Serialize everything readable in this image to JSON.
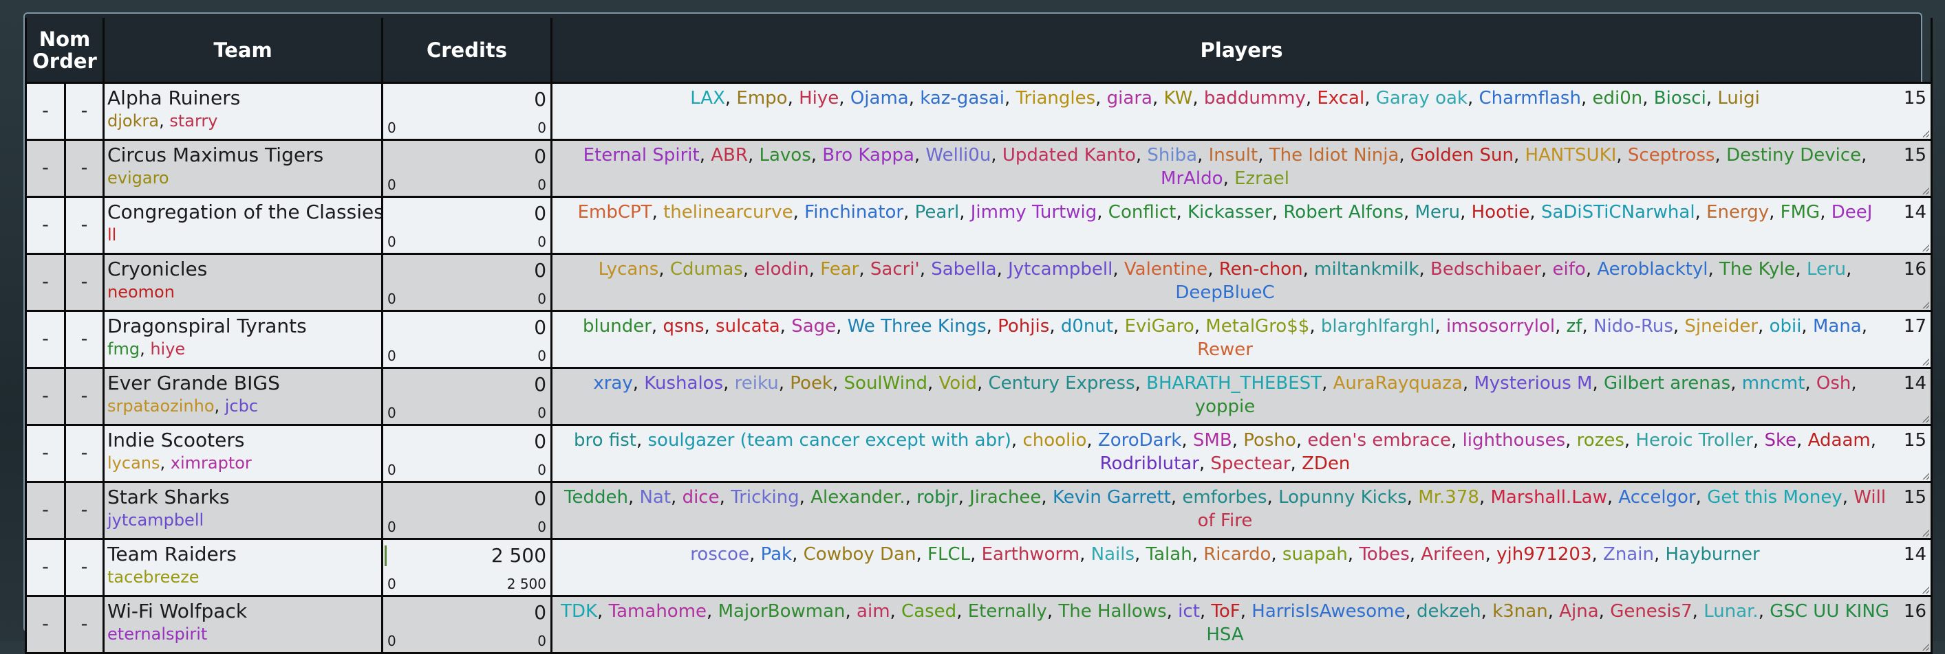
{
  "headers": {
    "order": "Nom Order",
    "team": "Team",
    "credits": "Credits",
    "players": "Players"
  },
  "rows": [
    {
      "order": "-",
      "nom": "-",
      "team": "Alpha Ruiners",
      "coaches": [
        {
          "name": "djokra",
          "color": "#9a7a16"
        },
        {
          "name": "starry",
          "color": "#c0304a"
        }
      ],
      "credits": "0",
      "credits_a": "0",
      "credits_b": "0",
      "count": "15",
      "players": [
        {
          "n": "LAX",
          "c": "#1aa6b0"
        },
        {
          "n": "Empo",
          "c": "#9a7a16"
        },
        {
          "n": "Hiye",
          "c": "#c0304a"
        },
        {
          "n": "Ojama",
          "c": "#2f6fd0"
        },
        {
          "n": "kaz-gasai",
          "c": "#2f6fd0"
        },
        {
          "n": "Triangles",
          "c": "#b8900e"
        },
        {
          "n": "giara",
          "c": "#b030a0"
        },
        {
          "n": "KW",
          "c": "#9a8a10"
        },
        {
          "n": "baddummy",
          "c": "#c0305a"
        },
        {
          "n": "Excal",
          "c": "#d02020"
        },
        {
          "n": "Garay oak",
          "c": "#30a8b0"
        },
        {
          "n": "Charmflash",
          "c": "#2f6fd0"
        },
        {
          "n": "edi0n",
          "c": "#2f8a2f"
        },
        {
          "n": "Biosci",
          "c": "#208a40"
        },
        {
          "n": "Luigi",
          "c": "#9a7a16"
        }
      ]
    },
    {
      "order": "-",
      "nom": "-",
      "team": "Circus Maximus Tigers",
      "coaches": [
        {
          "name": "evigaro",
          "color": "#9a8a10"
        }
      ],
      "credits": "0",
      "credits_a": "0",
      "credits_b": "0",
      "count": "15",
      "players": [
        {
          "n": "Eternal Spirit",
          "c": "#9a30c0"
        },
        {
          "n": "ABR",
          "c": "#c0304a"
        },
        {
          "n": "Lavos",
          "c": "#2f8a2f"
        },
        {
          "n": "Bro Kappa",
          "c": "#9a30c0"
        },
        {
          "n": "Welli0u",
          "c": "#6a6ad0"
        },
        {
          "n": "Updated Kanto",
          "c": "#c0305a"
        },
        {
          "n": "Shiba",
          "c": "#6a8ad0"
        },
        {
          "n": "Insult",
          "c": "#c06a30"
        },
        {
          "n": "The Idiot Ninja",
          "c": "#c06a30"
        },
        {
          "n": "Golden Sun",
          "c": "#c02020"
        },
        {
          "n": "HANTSUKI",
          "c": "#c09020"
        },
        {
          "n": "Sceptross",
          "c": "#d06030"
        },
        {
          "n": "Destiny Device",
          "c": "#2f8a2f"
        },
        {
          "n": "MrAldo",
          "c": "#a030c0"
        },
        {
          "n": "Ezrael",
          "c": "#7a9a20"
        }
      ]
    },
    {
      "order": "-",
      "nom": "-",
      "team": "Congregation of the Classiest",
      "coaches": [
        {
          "name": "ll",
          "color": "#d02020"
        }
      ],
      "credits": "0",
      "credits_a": "0",
      "credits_b": "0",
      "count": "14",
      "players": [
        {
          "n": "EmbCPT",
          "c": "#d06030"
        },
        {
          "n": "thelinearcurve",
          "c": "#c09020"
        },
        {
          "n": "Finchinator",
          "c": "#2f6fd0"
        },
        {
          "n": "Pearl",
          "c": "#208a8a"
        },
        {
          "n": "Jimmy Turtwig",
          "c": "#9a30c0"
        },
        {
          "n": "Conflict",
          "c": "#2f8a2f"
        },
        {
          "n": "Kickasser",
          "c": "#208a40"
        },
        {
          "n": "Robert Alfons",
          "c": "#208a40"
        },
        {
          "n": "Meru",
          "c": "#208a8a"
        },
        {
          "n": "Hootie",
          "c": "#c02020"
        },
        {
          "n": "SaDiSTiCNarwhal",
          "c": "#1a9ab0"
        },
        {
          "n": "Energy",
          "c": "#c06a30"
        },
        {
          "n": "FMG",
          "c": "#2f8a2f"
        },
        {
          "n": "DeeJ",
          "c": "#a030c0"
        }
      ]
    },
    {
      "order": "-",
      "nom": "-",
      "team": "Cryonicles",
      "coaches": [
        {
          "name": "neomon",
          "color": "#c02020"
        }
      ],
      "credits": "0",
      "credits_a": "0",
      "credits_b": "0",
      "count": "16",
      "players": [
        {
          "n": "Lycans",
          "c": "#c09020"
        },
        {
          "n": "Cdumas",
          "c": "#9a9a20"
        },
        {
          "n": "elodin",
          "c": "#c0305a"
        },
        {
          "n": "Fear",
          "c": "#b8900e"
        },
        {
          "n": "Sacri'",
          "c": "#c0304a"
        },
        {
          "n": "Sabella",
          "c": "#6a4ad0"
        },
        {
          "n": "Jytcampbell",
          "c": "#6a4ad0"
        },
        {
          "n": "Valentine",
          "c": "#d06030"
        },
        {
          "n": "Ren-chon",
          "c": "#c02020"
        },
        {
          "n": "miltankmilk",
          "c": "#208a8a"
        },
        {
          "n": "Bedschibaer",
          "c": "#c0305a"
        },
        {
          "n": "eifo",
          "c": "#b030a0"
        },
        {
          "n": "Aeroblacktyl",
          "c": "#2f6fd0"
        },
        {
          "n": "The Kyle",
          "c": "#2f8a2f"
        },
        {
          "n": "Leru",
          "c": "#30a8b0"
        },
        {
          "n": "DeepBlueC",
          "c": "#2f6fd0"
        }
      ]
    },
    {
      "order": "-",
      "nom": "-",
      "team": "Dragonspiral Tyrants",
      "coaches": [
        {
          "name": "fmg",
          "color": "#2f8a2f"
        },
        {
          "name": "hiye",
          "color": "#c0304a"
        }
      ],
      "credits": "0",
      "credits_a": "0",
      "credits_b": "0",
      "count": "17",
      "players": [
        {
          "n": "blunder",
          "c": "#2f8a2f"
        },
        {
          "n": "qsns",
          "c": "#c02020"
        },
        {
          "n": "sulcata",
          "c": "#d02020"
        },
        {
          "n": "Sage",
          "c": "#b030a0"
        },
        {
          "n": "We Three Kings",
          "c": "#1a80b0"
        },
        {
          "n": "Pohjis",
          "c": "#c02020"
        },
        {
          "n": "d0nut",
          "c": "#1a8ab0"
        },
        {
          "n": "EviGaro",
          "c": "#8a9a10"
        },
        {
          "n": "MetalGro$$",
          "c": "#8a9a10"
        },
        {
          "n": "blarghlfarghl",
          "c": "#30a0a0"
        },
        {
          "n": "imsosorrylol",
          "c": "#b030a0"
        },
        {
          "n": "zf",
          "c": "#208a40"
        },
        {
          "n": "Nido-Rus",
          "c": "#6a6ad0"
        },
        {
          "n": "Sjneider",
          "c": "#c09020"
        },
        {
          "n": "obii",
          "c": "#1a9ab0"
        },
        {
          "n": "Mana",
          "c": "#2f6fd0"
        },
        {
          "n": "Rewer",
          "c": "#d06030"
        }
      ]
    },
    {
      "order": "-",
      "nom": "-",
      "team": "Ever Grande BIGS",
      "coaches": [
        {
          "name": "srpataozinho",
          "color": "#c09020"
        },
        {
          "name": "jcbc",
          "color": "#6a4ad0"
        }
      ],
      "credits": "0",
      "credits_a": "0",
      "credits_b": "0",
      "count": "14",
      "players": [
        {
          "n": "xray",
          "c": "#2f6fd0"
        },
        {
          "n": "Kushalos",
          "c": "#6a4ad0"
        },
        {
          "n": "reiku",
          "c": "#7a8ad0"
        },
        {
          "n": "Poek",
          "c": "#9a7a16"
        },
        {
          "n": "SoulWind",
          "c": "#5a9a10"
        },
        {
          "n": "Void",
          "c": "#8a9a10"
        },
        {
          "n": "Century Express",
          "c": "#208a8a"
        },
        {
          "n": "BHARATH_THEBEST",
          "c": "#1aa6b0"
        },
        {
          "n": "AuraRayquaza",
          "c": "#c09020"
        },
        {
          "n": "Mysterious M",
          "c": "#6a4ad0"
        },
        {
          "n": "Gilbert arenas",
          "c": "#208a40"
        },
        {
          "n": "mncmt",
          "c": "#1a9ab0"
        },
        {
          "n": "Osh",
          "c": "#c0305a"
        },
        {
          "n": "yoppie",
          "c": "#2f8a2f"
        }
      ]
    },
    {
      "order": "-",
      "nom": "-",
      "team": "Indie Scooters",
      "coaches": [
        {
          "name": "lycans",
          "color": "#c09020"
        },
        {
          "name": "ximraptor",
          "color": "#b030a0"
        }
      ],
      "credits": "0",
      "credits_a": "0",
      "credits_b": "0",
      "count": "15",
      "players": [
        {
          "n": "bro fist",
          "c": "#208a8a"
        },
        {
          "n": "soulgazer (team cancer except with abr)",
          "c": "#1a9ab0"
        },
        {
          "n": "choolio",
          "c": "#b8900e"
        },
        {
          "n": "ZoroDark",
          "c": "#2f6fd0"
        },
        {
          "n": "SMB",
          "c": "#b030a0"
        },
        {
          "n": "Posho",
          "c": "#9a7a16"
        },
        {
          "n": "eden's embrace",
          "c": "#c0305a"
        },
        {
          "n": "lighthouses",
          "c": "#b030a0"
        },
        {
          "n": "rozes",
          "c": "#7a9a10"
        },
        {
          "n": "Heroic Troller",
          "c": "#30a0a0"
        },
        {
          "n": "Ske",
          "c": "#a020a0"
        },
        {
          "n": "Adaam",
          "c": "#c02020"
        },
        {
          "n": "Rodriblutar",
          "c": "#6a30c0"
        },
        {
          "n": "Spectear",
          "c": "#c0304a"
        },
        {
          "n": "ZDen",
          "c": "#c02020"
        }
      ]
    },
    {
      "order": "-",
      "nom": "-",
      "team": "Stark Sharks",
      "coaches": [
        {
          "name": "jytcampbell",
          "color": "#6a4ad0"
        }
      ],
      "credits": "0",
      "credits_a": "0",
      "credits_b": "0",
      "count": "15",
      "players": [
        {
          "n": "Teddeh",
          "c": "#208a40"
        },
        {
          "n": "Nat",
          "c": "#6a6ad0"
        },
        {
          "n": "dice",
          "c": "#b030a0"
        },
        {
          "n": "Tricking",
          "c": "#6a6ad0"
        },
        {
          "n": "Alexander.",
          "c": "#2f8a2f"
        },
        {
          "n": "robjr",
          "c": "#208a40"
        },
        {
          "n": "Jirachee",
          "c": "#2f8a2f"
        },
        {
          "n": "Kevin Garrett",
          "c": "#1a80b0"
        },
        {
          "n": "emforbes",
          "c": "#208a8a"
        },
        {
          "n": "Lopunny Kicks",
          "c": "#208a8a"
        },
        {
          "n": "Mr.378",
          "c": "#9a9a10"
        },
        {
          "n": "Marshall.Law",
          "c": "#d02040"
        },
        {
          "n": "Accelgor",
          "c": "#2f6fd0"
        },
        {
          "n": "Get this Money",
          "c": "#1aa6b0"
        },
        {
          "n": "Will of Fire",
          "c": "#c0304a"
        }
      ]
    },
    {
      "order": "-",
      "nom": "-",
      "team": "Team Raiders",
      "coaches": [
        {
          "name": "tacebreeze",
          "color": "#9a9a10"
        }
      ],
      "credits": "2 500",
      "credits_a": "0",
      "credits_b": "2 500",
      "count": "14",
      "players": [
        {
          "n": "roscoe",
          "c": "#6a6ad0"
        },
        {
          "n": "Pak",
          "c": "#2f6fd0"
        },
        {
          "n": "Cowboy Dan",
          "c": "#9a7a16"
        },
        {
          "n": "FLCL",
          "c": "#2f8a2f"
        },
        {
          "n": "Earthworm",
          "c": "#c0304a"
        },
        {
          "n": "Nails",
          "c": "#30a8b0"
        },
        {
          "n": "Talah",
          "c": "#2f8a2f"
        },
        {
          "n": "Ricardo",
          "c": "#c06a30"
        },
        {
          "n": "suapah",
          "c": "#7a9a10"
        },
        {
          "n": "Tobes",
          "c": "#c0305a"
        },
        {
          "n": "Arifeen",
          "c": "#c0304a"
        },
        {
          "n": "yjh971203",
          "c": "#c02020"
        },
        {
          "n": "Znain",
          "c": "#6a6ad0"
        },
        {
          "n": "Hayburner",
          "c": "#208a8a"
        }
      ]
    },
    {
      "order": "-",
      "nom": "-",
      "team": "Wi-Fi Wolfpack",
      "coaches": [
        {
          "name": "eternalspirit",
          "color": "#9a30c0"
        }
      ],
      "credits": "0",
      "credits_a": "0",
      "credits_b": "0",
      "count": "16",
      "players": [
        {
          "n": "TDK",
          "c": "#1aa6b0"
        },
        {
          "n": "Tamahome",
          "c": "#b030a0"
        },
        {
          "n": "MajorBowman",
          "c": "#2f8a2f"
        },
        {
          "n": "aim",
          "c": "#c0305a"
        },
        {
          "n": "Cased",
          "c": "#5a9a10"
        },
        {
          "n": "Eternally",
          "c": "#2f8a2f"
        },
        {
          "n": "The Hallows",
          "c": "#2f8a2f"
        },
        {
          "n": "ict",
          "c": "#6a4ad0"
        },
        {
          "n": "ToF",
          "c": "#c02020"
        },
        {
          "n": "HarrisIsAwesome",
          "c": "#2f6fd0"
        },
        {
          "n": "dekzeh",
          "c": "#208a8a"
        },
        {
          "n": "k3nan",
          "c": "#9a7a16"
        },
        {
          "n": "Ajna",
          "c": "#c0304a"
        },
        {
          "n": "Genesis7",
          "c": "#c0304a"
        },
        {
          "n": "Lunar.",
          "c": "#30a8b0"
        },
        {
          "n": "GSC UU KING HSA",
          "c": "#208a40"
        }
      ]
    }
  ]
}
